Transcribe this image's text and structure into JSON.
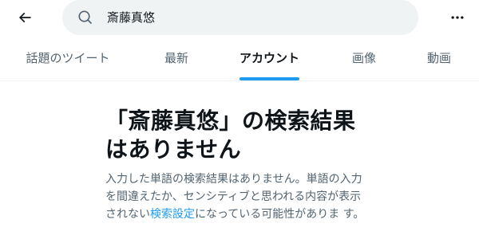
{
  "search": {
    "query": "斎藤真悠"
  },
  "tabs": [
    {
      "label": "話題のツイート",
      "active": false
    },
    {
      "label": "最新",
      "active": false
    },
    {
      "label": "アカウント",
      "active": true
    },
    {
      "label": "画像",
      "active": false
    },
    {
      "label": "動画",
      "active": false
    }
  ],
  "empty_state": {
    "title": "「斎藤真悠」の検索結果はありません",
    "desc_before": "入力した単語の検索結果はありません。単語の入力を間違えたか、センシティブと思われる内容が表示されない",
    "desc_link": "検索設定",
    "desc_after": "になっている可能性がありま す。"
  },
  "icons": {
    "back": "arrow-left-icon",
    "search": "search-icon",
    "more": "more-horizontal-icon"
  },
  "colors": {
    "accent": "#1d9bf0",
    "text_primary": "#0f1419",
    "text_secondary": "#536471",
    "search_bg": "#eff3f4"
  }
}
